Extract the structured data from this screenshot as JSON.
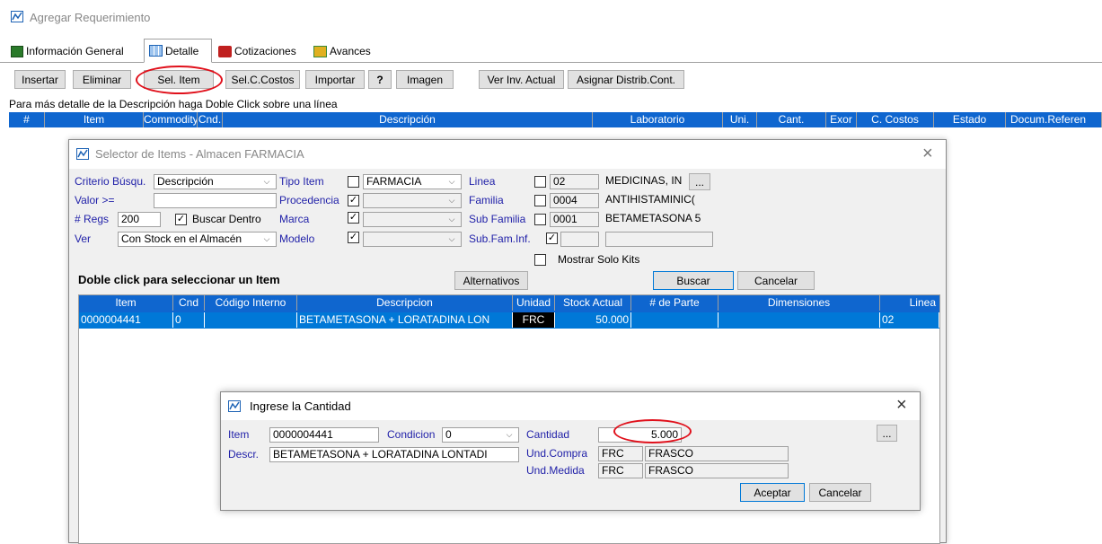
{
  "window": {
    "title": "Agregar Requerimiento"
  },
  "tabs": [
    {
      "label": "Información General",
      "icon": "computer-icon"
    },
    {
      "label": "Detalle",
      "icon": "grid-icon"
    },
    {
      "label": "Cotizaciones",
      "icon": "cotizaciones-icon"
    },
    {
      "label": "Avances",
      "icon": "avances-icon"
    }
  ],
  "toolbar": {
    "insertar": "Insertar",
    "eliminar": "Eliminar",
    "sel_item": "Sel. Item",
    "sel_costos": "Sel.C.Costos",
    "importar": "Importar",
    "help": "?",
    "imagen": "Imagen",
    "ver_inv": "Ver Inv. Actual",
    "asignar": "Asignar Distrib.Cont."
  },
  "hint": "Para más detalle de la Descripción haga Doble Click sobre una línea",
  "main_grid": {
    "columns": [
      "#",
      "Item",
      "Commodity",
      "Cnd.",
      "Descripción",
      "Laboratorio",
      "Uni.",
      "Cant.",
      "Exor",
      "C. Costos",
      "Estado",
      "Docum.Referen"
    ]
  },
  "selector": {
    "title": "Selector de Items - Almacen FARMACIA",
    "criterio_label": "Criterio Búsqu.",
    "criterio_value": "Descripción",
    "valor_label": "Valor >=",
    "valor_value": "",
    "regs_label": "# Regs",
    "regs_value": "200",
    "buscar_dentro": "Buscar Dentro",
    "ver_label": "Ver",
    "ver_value": "Con Stock en el Almacén",
    "tipo_item_label": "Tipo Item",
    "tipo_item_value": "FARMACIA",
    "procedencia_label": "Procedencia",
    "marca_label": "Marca",
    "modelo_label": "Modelo",
    "linea_label": "Linea",
    "linea_code": "02",
    "linea_desc": "MEDICINAS, IN",
    "familia_label": "Familia",
    "familia_code": "0004",
    "familia_desc": "ANTIHISTAMINIC(",
    "subfamilia_label": "Sub Familia",
    "subfamilia_code": "0001",
    "subfamilia_desc": "BETAMETASONA 5",
    "subfaminf_label": "Sub.Fam.Inf.",
    "mostrar_kits": "Mostrar Solo Kits",
    "more_btn": "...",
    "heading": "Doble click para seleccionar un Item",
    "alternativos": "Alternativos",
    "buscar": "Buscar",
    "cancelar": "Cancelar",
    "columns": [
      "Item",
      "Cnd",
      "Código Interno",
      "Descripcion",
      "Unidad",
      "Stock Actual",
      "# de Parte",
      "Dimensiones",
      "Linea"
    ],
    "rows": [
      {
        "item": "0000004441",
        "cnd": "0",
        "codigo": "",
        "descripcion": "BETAMETASONA + LORATADINA  LON",
        "unidad": "FRC",
        "stock": "50.000",
        "parte": "",
        "dimensiones": "",
        "linea": "02"
      }
    ]
  },
  "cantidad_dialog": {
    "title": "Ingrese la Cantidad",
    "close": "×",
    "item_label": "Item",
    "item_value": "0000004441",
    "condicion_label": "Condicion",
    "condicion_value": "0",
    "cantidad_label": "Cantidad",
    "cantidad_value": "5.000",
    "descr_label": "Descr.",
    "descr_value": "BETAMETASONA + LORATADINA  LONTADI",
    "und_compra_label": "Und.Compra",
    "und_compra_code": "FRC",
    "und_compra_desc": "FRASCO",
    "und_medida_label": "Und.Medida",
    "und_medida_code": "FRC",
    "und_medida_desc": "FRASCO",
    "more_btn": "...",
    "aceptar": "Aceptar",
    "cancelar": "Cancelar"
  },
  "selector_close": "×",
  "colors": {
    "selection": "#0078d7",
    "highlight_oval": "#e0101b",
    "label_blue": "#1f1fa8"
  }
}
